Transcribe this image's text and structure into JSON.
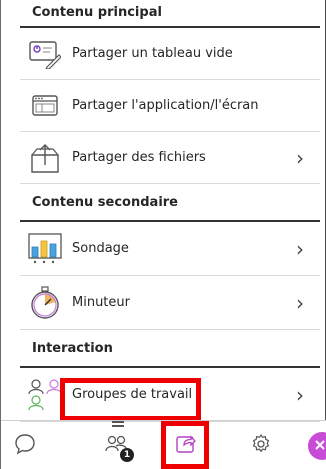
{
  "sections": {
    "main": {
      "title": "Contenu principal",
      "items": [
        {
          "label": "Partager un tableau vide",
          "icon": "whiteboard-icon"
        },
        {
          "label": "Partager l'application/l'écran",
          "icon": "app-window-icon"
        },
        {
          "label": "Partager des fichiers",
          "icon": "file-box-icon",
          "chevron": "›"
        }
      ]
    },
    "secondary": {
      "title": "Contenu secondaire",
      "items": [
        {
          "label": "Sondage",
          "icon": "poll-chart-icon",
          "chevron": "›"
        },
        {
          "label": "Minuteur",
          "icon": "stopwatch-icon",
          "chevron": "›"
        }
      ]
    },
    "interaction": {
      "title": "Interaction",
      "items": [
        {
          "label": "Groupes de travail",
          "icon": "breakout-groups-icon",
          "chevron": "›"
        }
      ]
    }
  },
  "toolbar": {
    "attendees_badge": "1",
    "buttons": [
      "chat-icon",
      "attendees-icon",
      "share-content-icon",
      "settings-icon",
      "collapse-icon"
    ]
  },
  "colors": {
    "highlight": "#e00000",
    "accent": "#c74bd6",
    "active_share": "#b341c2"
  }
}
